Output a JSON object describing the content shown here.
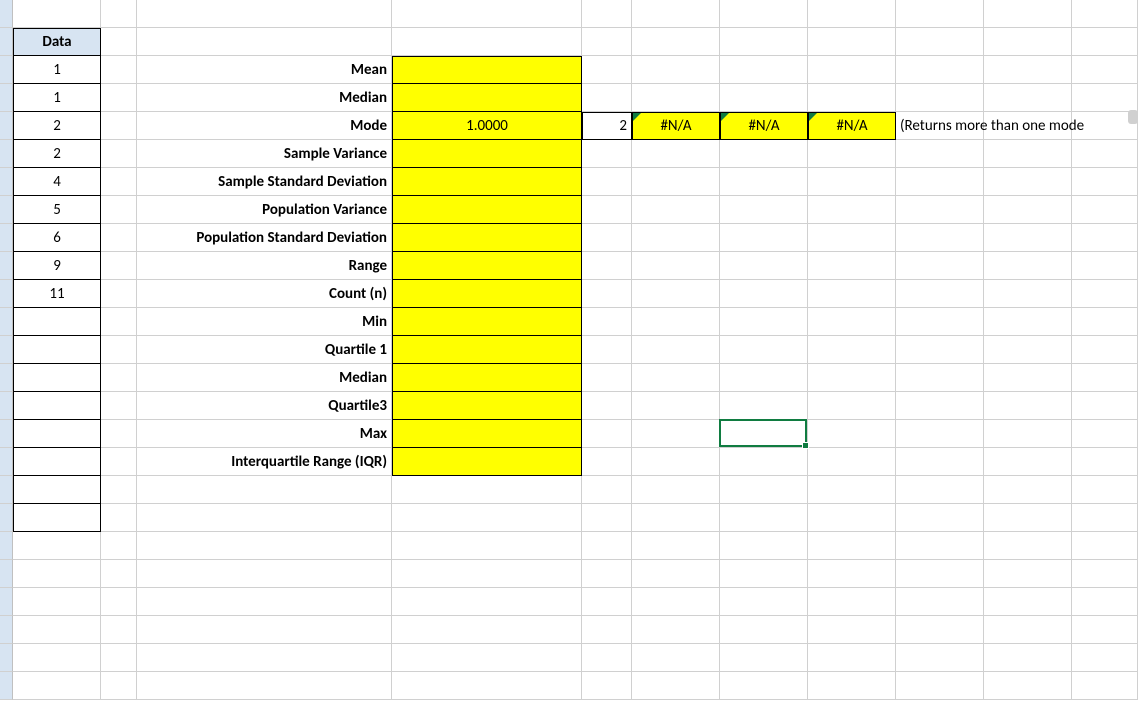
{
  "data_column": {
    "header": "Data",
    "values": [
      "1",
      "1",
      "2",
      "2",
      "4",
      "5",
      "6",
      "9",
      "11"
    ]
  },
  "stats_labels": [
    "Mean",
    "Median",
    "Mode",
    "Sample Variance",
    "Sample Standard Deviation",
    "Population Variance",
    "Population Standard Deviation",
    "Range",
    "Count (n)",
    "Min",
    "Quartile 1",
    "Median",
    "Quartile3",
    "Max",
    "Interquartile Range (IQR)"
  ],
  "stats_values": [
    "",
    "",
    "1.0000",
    "",
    "",
    "",
    "",
    "",
    "",
    "",
    "",
    "",
    "",
    "",
    ""
  ],
  "mode_extra": [
    "2",
    "#N/A",
    "#N/A",
    "#N/A"
  ],
  "mode_note": "(Returns more than one mode",
  "chart_data": {
    "type": "table",
    "title": "Descriptive statistics worksheet",
    "data_values": [
      1,
      1,
      2,
      2,
      4,
      5,
      6,
      9,
      11
    ],
    "statistics": [
      {
        "label": "Mean",
        "value": null
      },
      {
        "label": "Median",
        "value": null
      },
      {
        "label": "Mode",
        "value": 1.0
      },
      {
        "label": "Sample Variance",
        "value": null
      },
      {
        "label": "Sample Standard Deviation",
        "value": null
      },
      {
        "label": "Population Variance",
        "value": null
      },
      {
        "label": "Population Standard Deviation",
        "value": null
      },
      {
        "label": "Range",
        "value": null
      },
      {
        "label": "Count (n)",
        "value": null
      },
      {
        "label": "Min",
        "value": null
      },
      {
        "label": "Quartile 1",
        "value": null
      },
      {
        "label": "Median",
        "value": null
      },
      {
        "label": "Quartile3",
        "value": null
      },
      {
        "label": "Max",
        "value": null
      },
      {
        "label": "Interquartile Range (IQR)",
        "value": null
      }
    ],
    "mode_array_results": [
      2,
      "#N/A",
      "#N/A",
      "#N/A"
    ],
    "note": "(Returns more than one mode"
  }
}
